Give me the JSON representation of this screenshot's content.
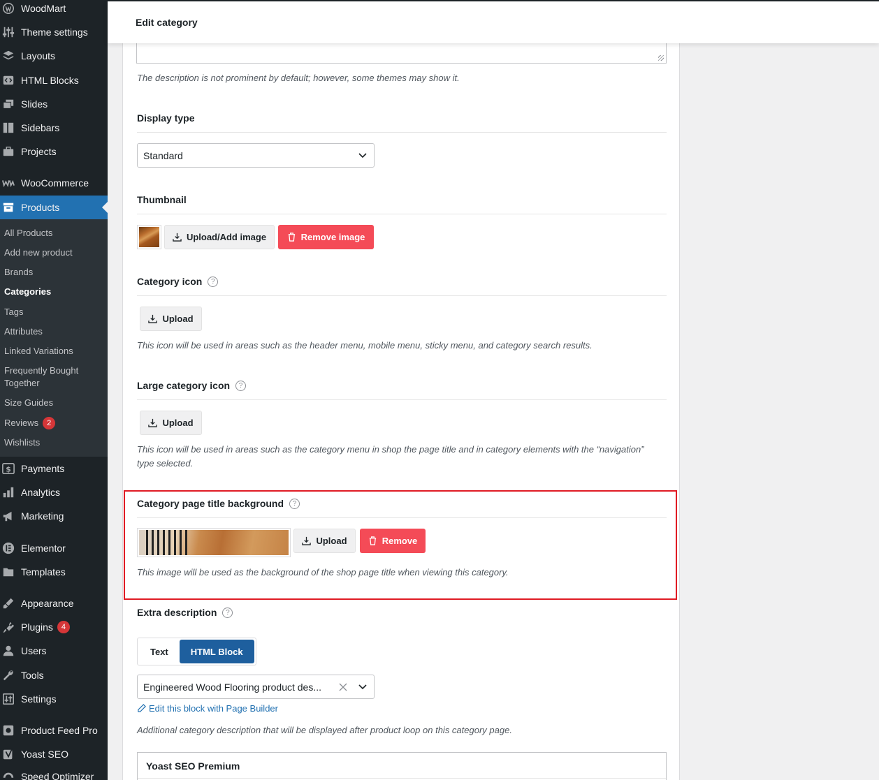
{
  "sidebar": {
    "top_items": [
      {
        "label": "WoodMart",
        "icon": "woodmart-icon"
      },
      {
        "label": "Theme settings",
        "icon": "sliders-icon"
      },
      {
        "label": "Layouts",
        "icon": "layers-icon"
      },
      {
        "label": "HTML Blocks",
        "icon": "code-block-icon"
      },
      {
        "label": "Slides",
        "icon": "slides-icon"
      },
      {
        "label": "Sidebars",
        "icon": "sidebar-layout-icon"
      },
      {
        "label": "Projects",
        "icon": "briefcase-icon"
      },
      {
        "label": "WooCommerce",
        "icon": "woocommerce-icon"
      },
      {
        "label": "Products",
        "icon": "archive-box-icon"
      }
    ],
    "submenu": [
      {
        "label": "All Products"
      },
      {
        "label": "Add new product"
      },
      {
        "label": "Brands"
      },
      {
        "label": "Categories"
      },
      {
        "label": "Tags"
      },
      {
        "label": "Attributes"
      },
      {
        "label": "Linked Variations"
      },
      {
        "label": "Frequently Bought Together"
      },
      {
        "label": "Size Guides"
      },
      {
        "label": "Reviews",
        "badge": "2"
      },
      {
        "label": "Wishlists"
      }
    ],
    "bottom_items": [
      {
        "label": "Payments",
        "icon": "dollar-icon"
      },
      {
        "label": "Analytics",
        "icon": "bar-chart-icon"
      },
      {
        "label": "Marketing",
        "icon": "megaphone-icon"
      },
      {
        "label": "Elementor",
        "icon": "elementor-icon"
      },
      {
        "label": "Templates",
        "icon": "folder-icon"
      },
      {
        "label": "Appearance",
        "icon": "paintbrush-icon"
      },
      {
        "label": "Plugins",
        "icon": "plug-icon",
        "badge": "4"
      },
      {
        "label": "Users",
        "icon": "user-icon"
      },
      {
        "label": "Tools",
        "icon": "wrench-icon"
      },
      {
        "label": "Settings",
        "icon": "settings-sliders-icon"
      },
      {
        "label": "Product Feed Pro",
        "icon": "feed-icon"
      },
      {
        "label": "Yoast SEO",
        "icon": "yoast-icon"
      },
      {
        "label": "Speed Optimizer",
        "icon": "speed-icon"
      }
    ]
  },
  "header": {
    "title": "Edit category"
  },
  "main": {
    "description_note": "The description is not prominent by default; however, some themes may show it.",
    "display_type": {
      "label": "Display type",
      "value": "Standard"
    },
    "thumbnail": {
      "label": "Thumbnail",
      "upload_label": "Upload/Add image",
      "remove_label": "Remove image"
    },
    "category_icon": {
      "label": "Category icon",
      "help": "?",
      "upload_label": "Upload",
      "note": "This icon will be used in areas such as the header menu, mobile menu, sticky menu, and category search results."
    },
    "large_category_icon": {
      "label": "Large category icon",
      "help": "?",
      "upload_label": "Upload",
      "note": "This icon will be used in areas such as the category menu in shop the page title and in category elements with the “navigation” type selected."
    },
    "title_background": {
      "label": "Category page title background",
      "help": "?",
      "upload_label": "Upload",
      "remove_label": "Remove",
      "note": "This image will be used as the background of the shop page title when viewing this category."
    },
    "extra_description": {
      "label": "Extra description",
      "help": "?",
      "tabs": [
        "Text",
        "HTML Block"
      ],
      "selected_tab": "HTML Block",
      "select_value": "Engineered Wood Flooring product des...",
      "edit_link": "Edit this block with Page Builder",
      "note": "Additional category description that will be displayed after product loop on this category page."
    },
    "yoast": {
      "title": "Yoast SEO Premium"
    }
  },
  "colors": {
    "accent": "#2271b1",
    "danger": "#f44b57",
    "sidebar_bg": "#1d2327",
    "highlight": "#e01b24"
  }
}
